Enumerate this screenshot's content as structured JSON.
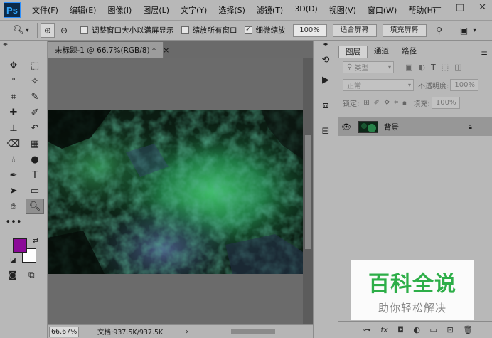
{
  "app": {
    "logo": "Ps"
  },
  "menubar": {
    "items": [
      "文件(F)",
      "编辑(E)",
      "图像(I)",
      "图层(L)",
      "文字(Y)",
      "选择(S)",
      "滤镜(T)",
      "3D(D)",
      "视图(V)",
      "窗口(W)",
      "帮助(H)"
    ],
    "window_buttons": [
      "—",
      "□",
      "✕"
    ]
  },
  "options": {
    "resize_windows_label": "调整窗口大小以满屏显示",
    "resize_windows_checked": false,
    "zoom_all_label": "缩放所有窗口",
    "zoom_all_checked": false,
    "scrubby_zoom_label": "细微缩放",
    "scrubby_zoom_checked": true,
    "percent_button": "100%",
    "fit_screen_button": "适合屏幕",
    "fill_screen_button": "填充屏幕"
  },
  "document": {
    "tab_title": "未标题-1 @ 66.7%(RGB/8) *",
    "close": "×"
  },
  "status": {
    "zoom": "66.67%",
    "doc_info": "文档:937.5K/937.5K",
    "arrow": "›"
  },
  "layers_panel": {
    "tabs": [
      "图层",
      "通道",
      "路径"
    ],
    "active_tab": 0,
    "filter_placeholder": "类型",
    "blend_mode": "正常",
    "opacity_label": "不透明度:",
    "opacity_value": "100%",
    "lock_label": "锁定:",
    "fill_label": "填充:",
    "fill_value": "100%",
    "layers": [
      {
        "name": "背景",
        "visible": true,
        "locked": true
      }
    ]
  },
  "colors": {
    "foreground": "#8b0a98",
    "background": "#ffffff"
  },
  "watermark": {
    "title": "百科全说",
    "subtitle": "助你轻松解决"
  }
}
